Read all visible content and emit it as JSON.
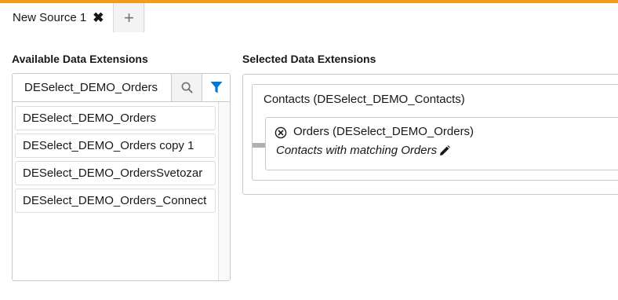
{
  "tabs": {
    "active_label": "New Source 1",
    "close_glyph": "✖",
    "add_glyph": "+"
  },
  "available": {
    "title": "Available Data Extensions",
    "search_value": "DESelect_DEMO_Orders",
    "items": [
      "DESelect_DEMO_Orders",
      "DESelect_DEMO_Orders copy 1",
      "DESelect_DEMO_OrdersSvetozar",
      "DESelect_DEMO_Orders_Connect"
    ]
  },
  "selected": {
    "title": "Selected Data Extensions",
    "primary_label": "Contacts (DESelect_DEMO_Contacts)",
    "joined_label": "Orders (DESelect_DEMO_Orders)",
    "relation_text": "Contacts with matching Orders"
  },
  "colors": {
    "accent": "#f49b1c",
    "filter_icon": "#0176d3"
  }
}
